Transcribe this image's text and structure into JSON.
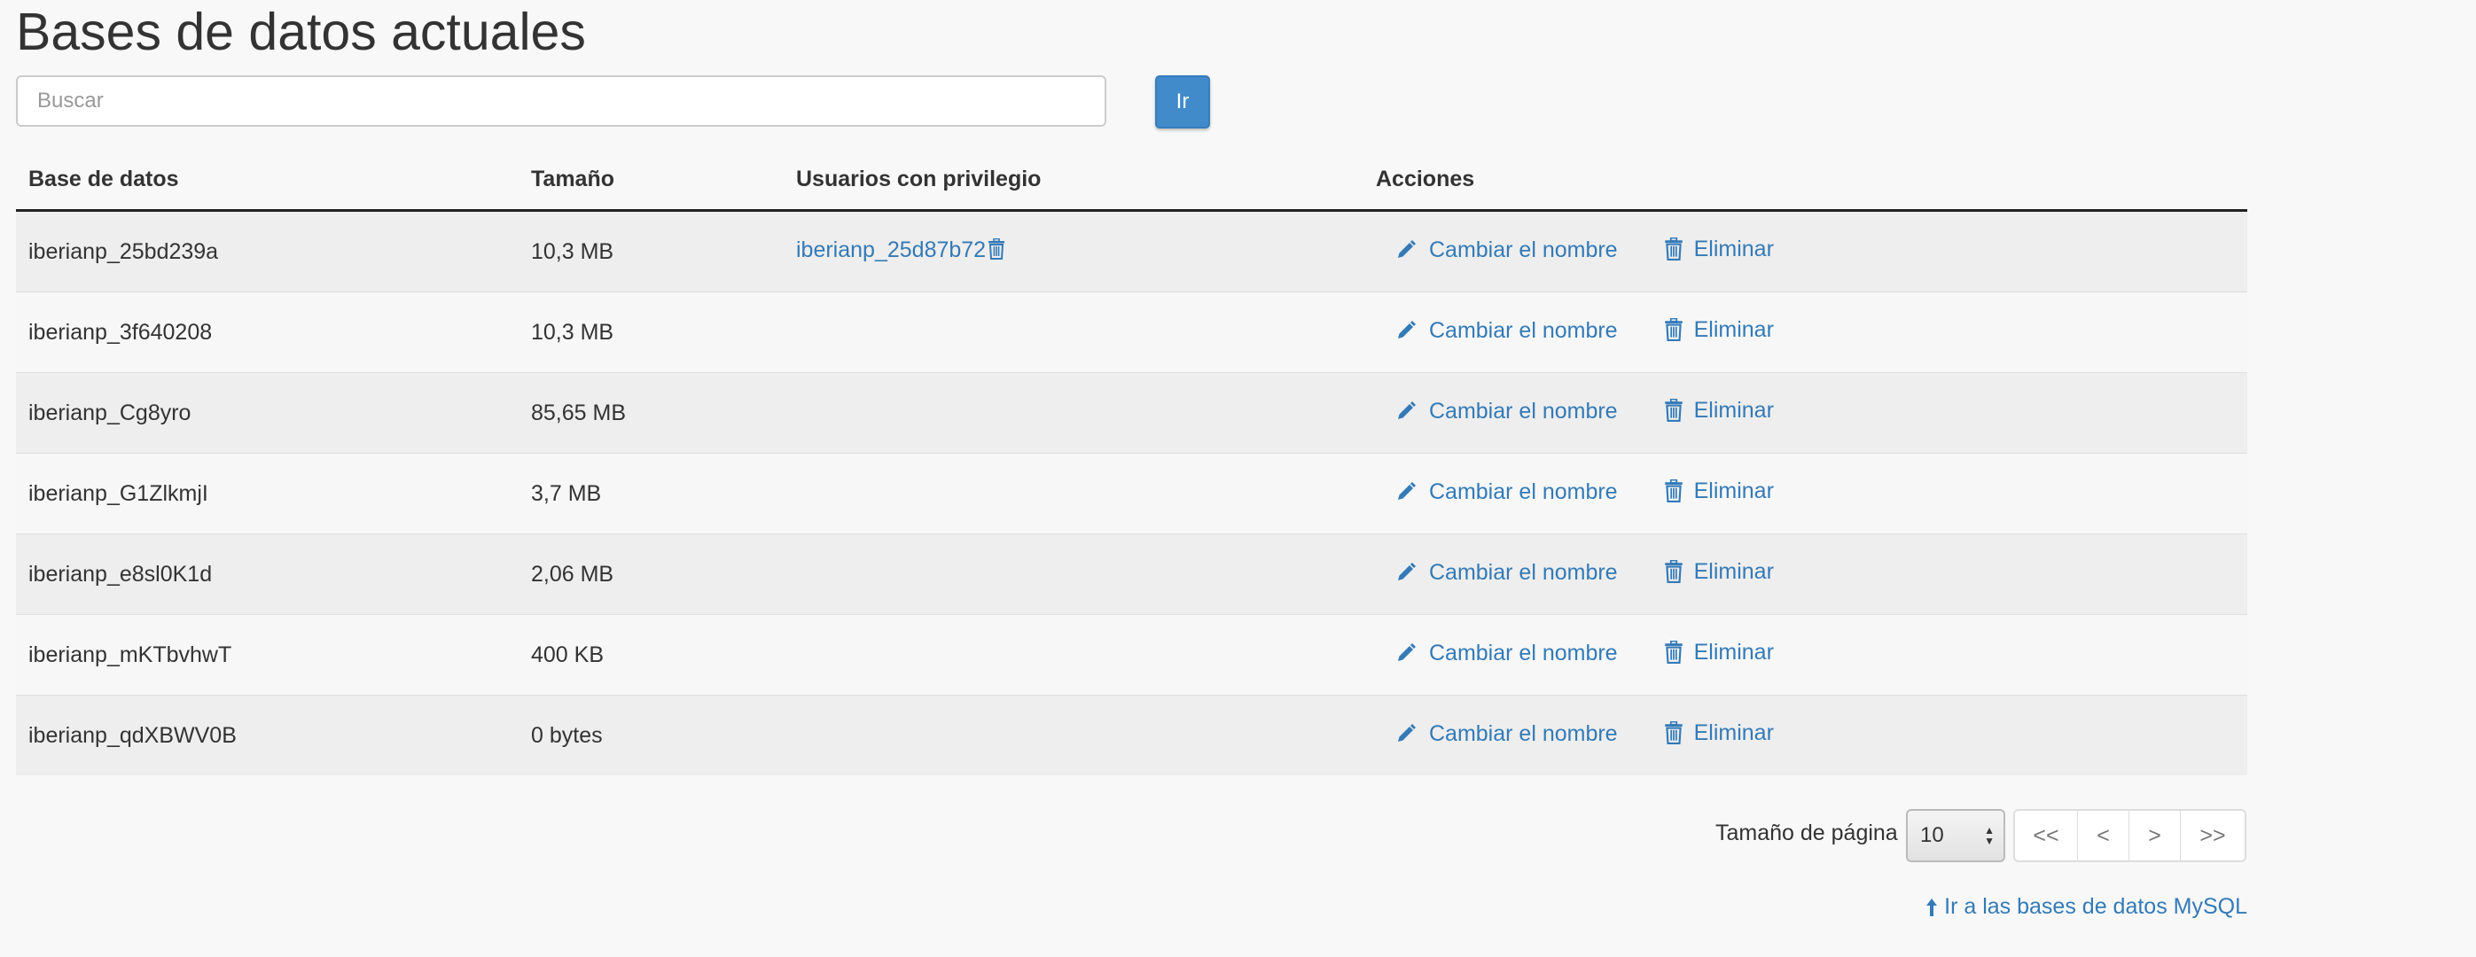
{
  "page": {
    "title": "Bases de datos actuales"
  },
  "search": {
    "placeholder": "Buscar",
    "value": "",
    "button_label": "Ir"
  },
  "table": {
    "headers": {
      "database": "Base de datos",
      "size": "Tamaño",
      "users": "Usuarios con privilegio",
      "actions": "Acciones"
    },
    "rename_label": "Cambiar el nombre",
    "delete_label": "Eliminar",
    "rows": [
      {
        "name": "iberianp_25bd239a",
        "size": "10,3 MB",
        "user": "iberianp_25d87b72"
      },
      {
        "name": "iberianp_3f640208",
        "size": "10,3 MB",
        "user": ""
      },
      {
        "name": "iberianp_Cg8yro",
        "size": "85,65 MB",
        "user": ""
      },
      {
        "name": "iberianp_G1ZlkmjI",
        "size": "3,7 MB",
        "user": ""
      },
      {
        "name": "iberianp_e8sl0K1d",
        "size": "2,06 MB",
        "user": ""
      },
      {
        "name": "iberianp_mKTbvhwT",
        "size": "400 KB",
        "user": ""
      },
      {
        "name": "iberianp_qdXBWV0B",
        "size": "0 bytes",
        "user": ""
      }
    ]
  },
  "pagination": {
    "page_size_label": "Tamaño de página",
    "page_size_value": "10",
    "first": "<<",
    "prev": "<",
    "next": ">",
    "last": ">>"
  },
  "footer": {
    "link_label": "Ir a las bases de datos MySQL"
  },
  "colors": {
    "link": "#337ab7",
    "button": "#428bca"
  },
  "icons": {
    "rename": "pencil-icon",
    "delete": "trash-icon",
    "back": "arrow-up-icon",
    "select": "select-arrows-icon"
  }
}
